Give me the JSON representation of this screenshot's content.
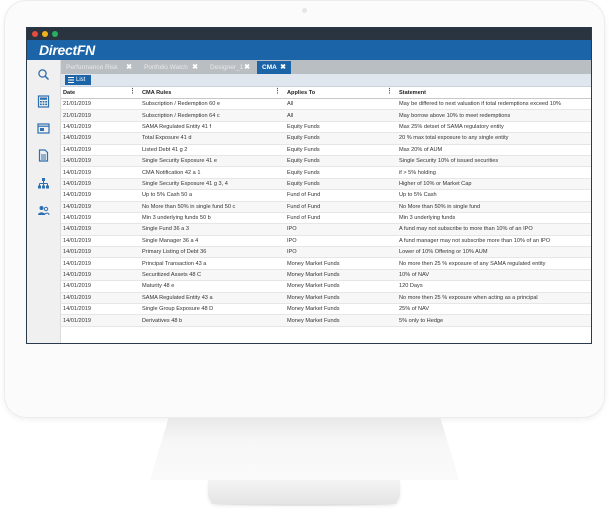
{
  "app": {
    "logo": "DirectFN"
  },
  "tabs": [
    {
      "label": "Performance Risk",
      "active": false
    },
    {
      "label": "Portfolio Watch",
      "active": false
    },
    {
      "label": "Designer_1",
      "active": false
    },
    {
      "label": "CMA",
      "active": true
    }
  ],
  "toolbar": {
    "list_label": "List"
  },
  "nav_icons": [
    "search-icon",
    "calculator-icon",
    "window-icon",
    "document-icon",
    "org-chart-icon",
    "users-icon"
  ],
  "table": {
    "columns": [
      "Date",
      "CMA Rules",
      "Applies To",
      "Statement"
    ],
    "rows": [
      [
        "21/01/2019",
        "Subscription / Redemption 60 e",
        "All",
        "May be differed to next valuation if total redemptions exceed 10%"
      ],
      [
        "21/01/2019",
        "Subscription / Redemption 64 c",
        "All",
        "May borrow above 10% to meet redemptions"
      ],
      [
        "14/01/2019",
        "SAMA Regulated Entity 41 f",
        "Equity Funds",
        "Max 25% detset of SAMA regulatory entity"
      ],
      [
        "14/01/2019",
        "Total Exposure 41 d",
        "Equity Funds",
        "20 % max total exposure to any single entity"
      ],
      [
        "14/01/2019",
        "Listed Debt 41 g 2",
        "Equity Funds",
        "Max 20% of AUM"
      ],
      [
        "14/01/2019",
        "Single Security Exposure 41 e",
        "Equity Funds",
        "Single Security 10% of issued securities"
      ],
      [
        "14/01/2019",
        "CMA Notification 42 a 1",
        "Equity Funds",
        "if > 5% holding"
      ],
      [
        "14/01/2019",
        "Single Security Exposure 41 g 3, 4",
        "Equity Funds",
        "Higher of 10% or Market Cap"
      ],
      [
        "14/01/2019",
        "Up to 5% Cash 50 a",
        "Fund of Fund",
        "Up to 5% Cash"
      ],
      [
        "14/01/2019",
        "No More than 50% in single fund 50 c",
        "Fund of Fund",
        "No More than 50% in single fund"
      ],
      [
        "14/01/2019",
        "Min 3 underlying funds 50 b",
        "Fund of Fund",
        "Min 3 underlying funds"
      ],
      [
        "14/01/2019",
        "Single Fund 36 a 3",
        "IPO",
        "A fund may not subscribe to more than 10% of an IPO"
      ],
      [
        "14/01/2019",
        "Single Manager 36 a 4",
        "IPO",
        "A fund manager may not subscribe more than 10% of an IPO"
      ],
      [
        "14/01/2019",
        "Primary Listing of Debt 36",
        "IPO",
        "Lower of 10% Offering or 10% AUM"
      ],
      [
        "14/01/2019",
        "Principal Transaction 43 a",
        "Money Market Funds",
        "No more then 25 % exposure of any SAMA regulated entity"
      ],
      [
        "14/01/2019",
        "Securitized Assets 48 C",
        "Money Market Funds",
        "10% of NAV"
      ],
      [
        "14/01/2019",
        "Maturity 48 e",
        "Money Market Funds",
        "120 Days"
      ],
      [
        "14/01/2019",
        "SAMA Regulated Entity 43 a",
        "Money Market Funds",
        "No more then 25 % exposure when acting as a principal"
      ],
      [
        "14/01/2019",
        "Single Group Exposure 48 D",
        "Money Market Funds",
        "25% of NAV"
      ],
      [
        "14/01/2019",
        "Derivatives 48 b",
        "Money Market Funds",
        "5% only to Hedge"
      ]
    ]
  }
}
